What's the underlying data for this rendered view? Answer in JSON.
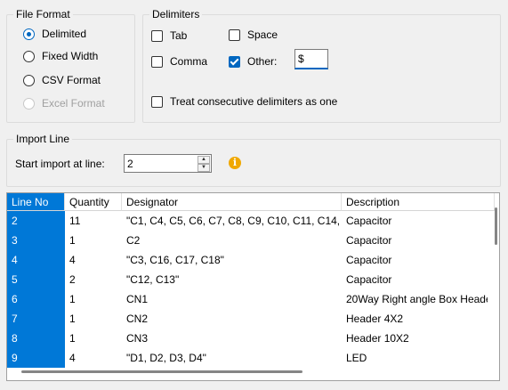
{
  "file_format": {
    "title": "File Format",
    "options": [
      {
        "label": "Delimited",
        "checked": true,
        "disabled": false
      },
      {
        "label": "Fixed Width",
        "checked": false,
        "disabled": false
      },
      {
        "label": "CSV Format",
        "checked": false,
        "disabled": false
      },
      {
        "label": "Excel Format",
        "checked": false,
        "disabled": true
      }
    ]
  },
  "delimiters": {
    "title": "Delimiters",
    "tab": {
      "label": "Tab",
      "checked": false
    },
    "space": {
      "label": "Space",
      "checked": false
    },
    "comma": {
      "label": "Comma",
      "checked": false
    },
    "other": {
      "label": "Other:",
      "checked": true,
      "value": "$"
    },
    "consecutive": {
      "label": "Treat consecutive delimiters as one",
      "checked": false
    }
  },
  "import_line": {
    "title": "Import Line",
    "label": "Start import at line:",
    "value": "2",
    "up_glyph": "▲",
    "down_glyph": "▼",
    "info_icon": "i"
  },
  "grid": {
    "columns": [
      "Line No",
      "Quantity",
      "Designator",
      "Description"
    ],
    "rows": [
      [
        "2",
        "11",
        "\"C1, C4, C5, C6, C7, C8, C9, C10, C11, C14, C...",
        "Capacitor"
      ],
      [
        "3",
        "1",
        "C2",
        "Capacitor"
      ],
      [
        "4",
        "4",
        "\"C3, C16, C17, C18\"",
        "Capacitor"
      ],
      [
        "5",
        "2",
        "\"C12, C13\"",
        "Capacitor"
      ],
      [
        "6",
        "1",
        "CN1",
        "20Way Right angle Box Heade"
      ],
      [
        "7",
        "1",
        "CN2",
        "Header 4X2"
      ],
      [
        "8",
        "1",
        "CN3",
        "Header 10X2"
      ],
      [
        "9",
        "4",
        "\"D1, D2, D3, D4\"",
        "LED"
      ]
    ]
  }
}
